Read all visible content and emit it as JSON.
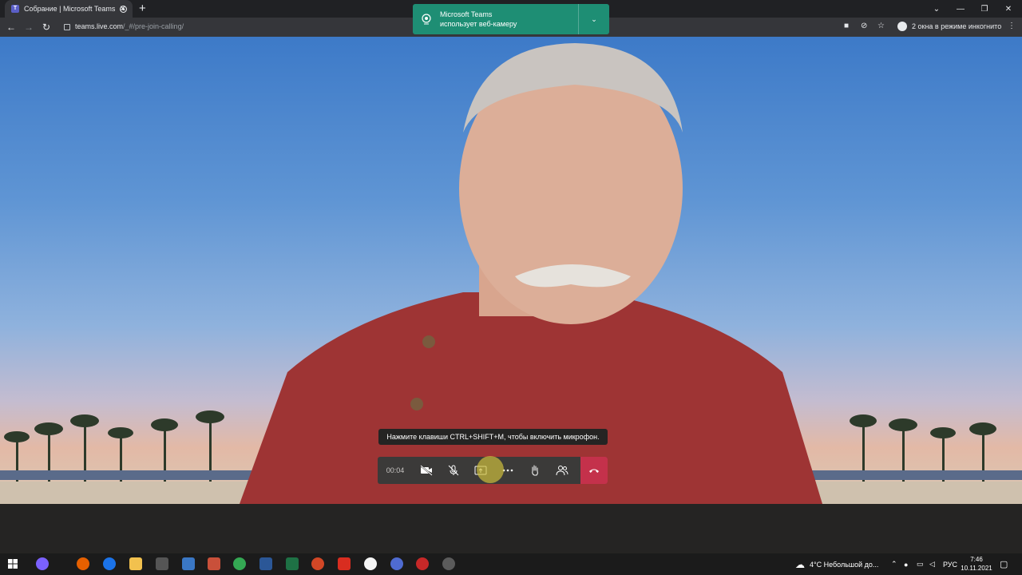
{
  "browser": {
    "tab_title": "Собрание | Microsoft Teams",
    "tab_favicon": "teams-icon",
    "url_main": "teams.live.com",
    "url_path": "/_#/pre-join-calling/",
    "incognito_label": "2 окна в режиме инкогнито"
  },
  "notification": {
    "title": "Microsoft Teams",
    "message": "использует веб-камеру",
    "color": "#1e8e74"
  },
  "call": {
    "tooltip": "Нажмите клавиши CTRL+SHIFT+M, чтобы включить микрофон.",
    "timer": "00:04",
    "hangup_color": "#c4314b",
    "controls": [
      "camera-off-icon",
      "mic-off-icon",
      "share-screen-icon",
      "more-icon",
      "raise-hand-icon",
      "participants-icon",
      "hang-up-icon"
    ]
  },
  "taskbar": {
    "weather": "4°C  Небольшой до...",
    "language": "РУС",
    "time": "7:46",
    "date": "10.11.2021"
  }
}
